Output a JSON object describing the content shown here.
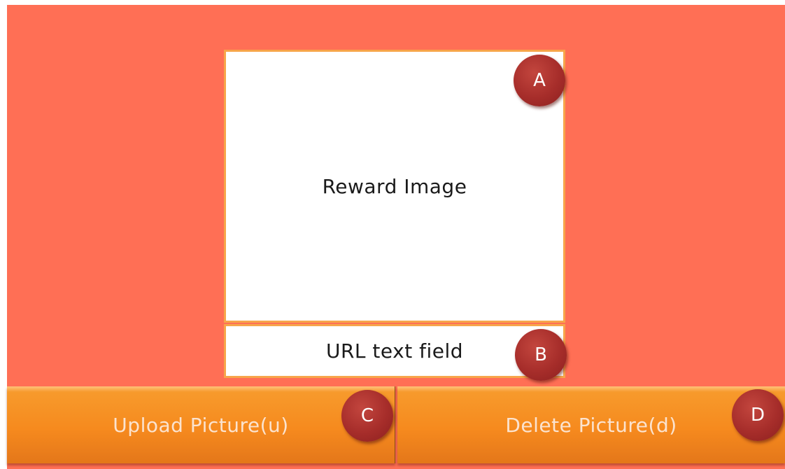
{
  "image_box": {
    "label": "Reward Image"
  },
  "url_field": {
    "label": "URL text field"
  },
  "buttons": {
    "upload_label": "Upload Picture(u)",
    "delete_label": "Delete Picture(d)"
  },
  "markers": [
    "A",
    "B",
    "C",
    "D"
  ],
  "colors": {
    "background": "#ff6f55",
    "border": "#f7a54a",
    "button": "#f68a1e",
    "marker": "#a62d2a"
  }
}
